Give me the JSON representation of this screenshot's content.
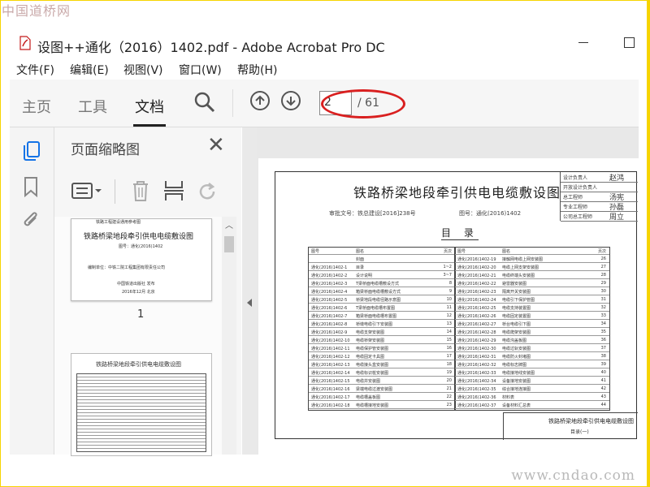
{
  "watermark": {
    "top": "中国道桥网",
    "bottom": "www.cndao.com"
  },
  "window": {
    "title": "设图++通化（2016）1402.pdf - Adobe Acrobat Pro DC"
  },
  "menu": [
    "文件(F)",
    "编辑(E)",
    "视图(V)",
    "窗口(W)",
    "帮助(H)"
  ],
  "tabs": {
    "home": "主页",
    "tools": "工具",
    "document": "文档"
  },
  "navigation": {
    "current_page": "2",
    "total_pages": "/ 61"
  },
  "panel": {
    "title": "页面缩略图",
    "thumb_label": "1"
  },
  "thumb1": {
    "header": "铁路工程建设通用参考图",
    "title": "铁路桥梁地段牵引供电电缆敷设图",
    "code": "图号：通化(2016)1402",
    "unit": "编制单位：中铁二院工程集团有限责任公司",
    "publisher": "中国铁道出版社 发布",
    "date": "2016年12月 北京"
  },
  "thumb2": {
    "title": "铁路桥梁地段牵引供电电缆敷设图"
  },
  "document": {
    "title": "铁路桥梁地段牵引供电电缆敷设图",
    "approval": "审批文号：铁总建设[2016]238号",
    "drawing_no": "图号：通化(2016)1402",
    "toc_heading": "目 录",
    "stamp": [
      {
        "label": "设计负责人",
        "sign": "赵鸿"
      },
      {
        "label": "开放设计负责人",
        "sign": ""
      },
      {
        "label": "总工程师",
        "sign": "汤宪"
      },
      {
        "label": "专业工程师",
        "sign": "孙磊"
      },
      {
        "label": "公司总工程师",
        "sign": "周立"
      }
    ],
    "toc_left": [
      {
        "code": "图号",
        "name": "图名",
        "page": "页次"
      },
      {
        "code": "",
        "name": "封面",
        "page": ""
      },
      {
        "code": "通化(2016)1402-1",
        "name": "目录",
        "page": "1~2"
      },
      {
        "code": "通化(2016)1402-2",
        "name": "设计说明",
        "page": "3~7"
      },
      {
        "code": "通化(2016)1402-3",
        "name": "T梁桥面电缆槽敷设方式",
        "page": "8"
      },
      {
        "code": "通化(2016)1402-4",
        "name": "箱梁桥面电缆槽敷设方式",
        "page": "9"
      },
      {
        "code": "通化(2016)1402-5",
        "name": "桥梁地段电缆径路示意图",
        "page": "10"
      },
      {
        "code": "通化(2016)1402-6",
        "name": "T梁桥面电缆槽布置图",
        "page": "11"
      },
      {
        "code": "通化(2016)1402-7",
        "name": "箱梁桥面电缆槽布置图",
        "page": "12"
      },
      {
        "code": "通化(2016)1402-8",
        "name": "桥墩电缆引下安装图",
        "page": "13"
      },
      {
        "code": "通化(2016)1402-9",
        "name": "电缆支架安装图",
        "page": "14"
      },
      {
        "code": "通化(2016)1402-10",
        "name": "电缆桥架安装图",
        "page": "15"
      },
      {
        "code": "通化(2016)1402-11",
        "name": "电缆保护管安装图",
        "page": "16"
      },
      {
        "code": "通化(2016)1402-12",
        "name": "电缆固定卡具图",
        "page": "17"
      },
      {
        "code": "通化(2016)1402-13",
        "name": "电缆接头盒安装图",
        "page": "18"
      },
      {
        "code": "通化(2016)1402-14",
        "name": "电缆标识桩安装图",
        "page": "19"
      },
      {
        "code": "通化(2016)1402-15",
        "name": "电缆井安装图",
        "page": "20"
      },
      {
        "code": "通化(2016)1402-16",
        "name": "梁端电缆过渡安装图",
        "page": "21"
      },
      {
        "code": "通化(2016)1402-17",
        "name": "电缆槽盖板图",
        "page": "22"
      },
      {
        "code": "通化(2016)1402-18",
        "name": "电缆槽接地安装图",
        "page": "23"
      }
    ],
    "toc_right": [
      {
        "code": "图号",
        "name": "图名",
        "page": "页次"
      },
      {
        "code": "通化(2016)1402-19",
        "name": "接触网电缆上网安装图",
        "page": "26"
      },
      {
        "code": "通化(2016)1402-20",
        "name": "电缆上网支架安装图",
        "page": "27"
      },
      {
        "code": "通化(2016)1402-21",
        "name": "电缆终端头安装图",
        "page": "28"
      },
      {
        "code": "通化(2016)1402-22",
        "name": "避雷器安装图",
        "page": "29"
      },
      {
        "code": "通化(2016)1402-23",
        "name": "隔离开关安装图",
        "page": "30"
      },
      {
        "code": "通化(2016)1402-24",
        "name": "电缆引下保护管图",
        "page": "31"
      },
      {
        "code": "通化(2016)1402-25",
        "name": "电缆支持装置图",
        "page": "32"
      },
      {
        "code": "通化(2016)1402-26",
        "name": "电缆固定装置图",
        "page": "33"
      },
      {
        "code": "通化(2016)1402-27",
        "name": "桥台电缆引下图",
        "page": "34"
      },
      {
        "code": "通化(2016)1402-28",
        "name": "电缆爬架安装图",
        "page": "35"
      },
      {
        "code": "通化(2016)1402-29",
        "name": "电缆沟盖板图",
        "page": "36"
      },
      {
        "code": "通化(2016)1402-30",
        "name": "电缆过轨安装图",
        "page": "37"
      },
      {
        "code": "通化(2016)1402-31",
        "name": "电缆防火封堵图",
        "page": "38"
      },
      {
        "code": "通化(2016)1402-32",
        "name": "电缆标志牌图",
        "page": "39"
      },
      {
        "code": "通化(2016)1402-33",
        "name": "电缆接地线安装图",
        "page": "40"
      },
      {
        "code": "通化(2016)1402-34",
        "name": "设备接地安装图",
        "page": "41"
      },
      {
        "code": "通化(2016)1402-35",
        "name": "综合接地连接图",
        "page": "42"
      },
      {
        "code": "通化(2016)1402-36",
        "name": "材料表",
        "page": "43"
      },
      {
        "code": "通化(2016)1402-37",
        "name": "设备材料汇总表",
        "page": "44"
      }
    ],
    "title_block": {
      "title": "铁路桥梁地段牵引供电电缆敷设图",
      "subtitle": "目录(一)",
      "drawing_no": "通化(2016)1402"
    }
  },
  "colors": {
    "accent": "#1473e6",
    "annotation": "#d92020",
    "border": "#f6d400"
  }
}
